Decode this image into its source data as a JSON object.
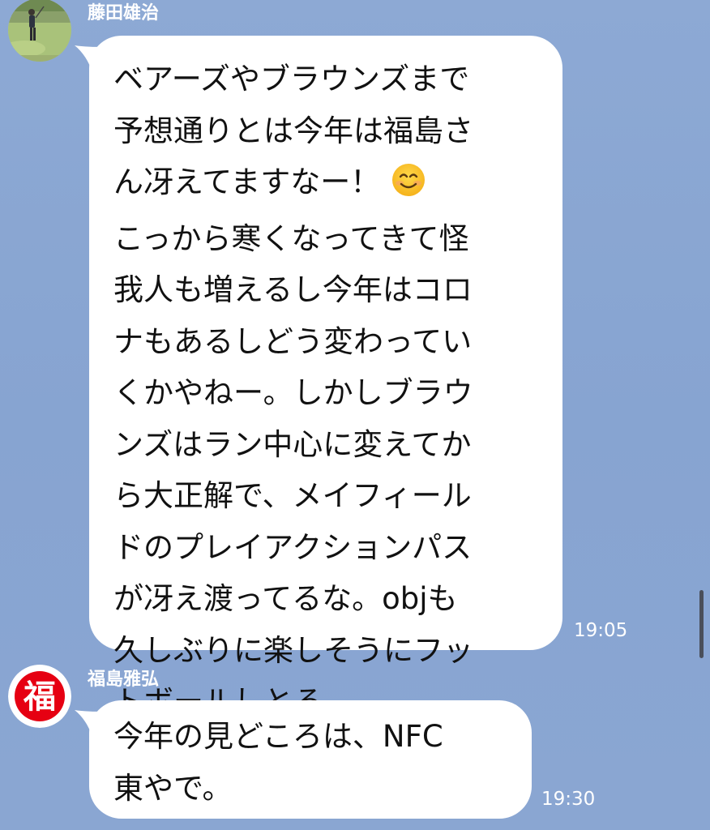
{
  "messages": [
    {
      "sender": "藤田雄治",
      "avatar_icon": "golfer-photo-avatar",
      "lines": [
        "ベアーズやブラウンズまで",
        "予想通りとは今年は福島さ",
        "ん冴えてますなー！",
        "こっから寒くなってきて怪",
        "我人も増えるし今年はコロ",
        "ナもあるしどう変わってい",
        "くかやねー。しかしブラウ",
        "ンズはラン中心に変えてか",
        "ら大正解で、メイフィール",
        "ドのプレイアクションパス",
        "が冴え渡ってるな。objも",
        "久しぶりに楽しそうにフッ",
        "トボールしとる"
      ],
      "emoji_icon": "smiling-face-emoji",
      "time": "19:05"
    },
    {
      "sender": "福島雅弘",
      "avatar_icon": "fuku-kanji-avatar",
      "avatar_text": "福",
      "lines": [
        "今年の見どころは、NFC",
        "東やで。"
      ],
      "time": "19:30"
    }
  ],
  "colors": {
    "background": "#8aa7d3",
    "bubble": "#ffffff",
    "text": "#111111",
    "meta_text": "#ffffff",
    "fuku_red": "#e60012"
  }
}
